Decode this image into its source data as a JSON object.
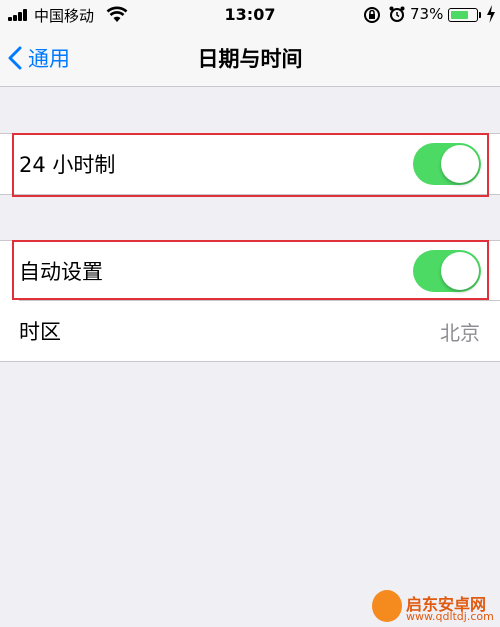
{
  "status_bar": {
    "carrier": "中国移动",
    "time": "13:07",
    "battery_percent_label": "73%",
    "battery_level": 0.73
  },
  "nav": {
    "back_label": "通用",
    "title": "日期与时间"
  },
  "settings": {
    "hour24": {
      "label": "24 小时制",
      "enabled": true
    },
    "auto_set": {
      "label": "自动设置",
      "enabled": true
    },
    "timezone": {
      "label": "时区",
      "value": "北京"
    }
  },
  "watermark": {
    "text": "启东安卓网",
    "url": "www.qdltdj.com"
  },
  "colors": {
    "accent": "#007aff",
    "toggle_on": "#4cd964",
    "highlight": "#e0303a",
    "background": "#efeff4"
  }
}
